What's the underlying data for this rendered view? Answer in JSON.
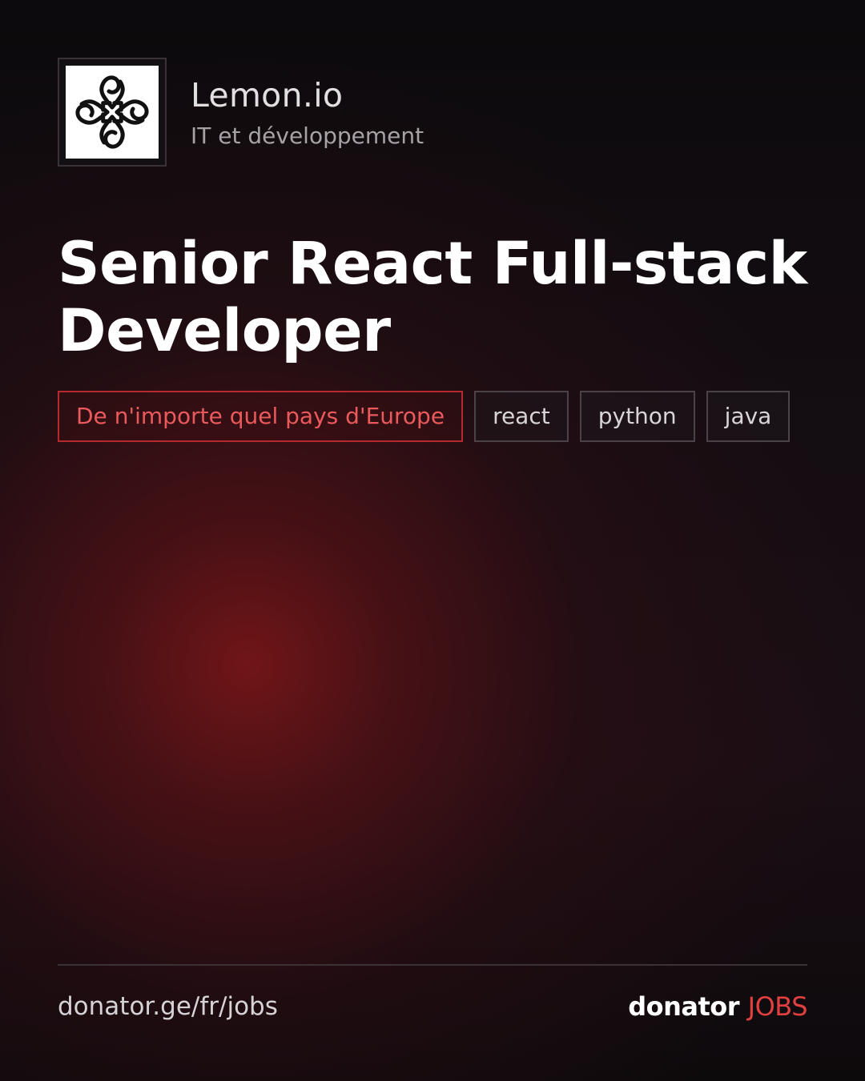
{
  "company": {
    "name": "Lemon.io",
    "category": "IT et développement",
    "logo_icon": "lemon-io-ornament-logo"
  },
  "job": {
    "title": "Senior React Full-stack Developer"
  },
  "tags": [
    {
      "label": "De n'importe quel pays d'Europe",
      "kind": "location"
    },
    {
      "label": "react",
      "kind": "skill"
    },
    {
      "label": "python",
      "kind": "skill"
    },
    {
      "label": "java",
      "kind": "skill"
    }
  ],
  "footer": {
    "url": "donator.ge/fr/jobs",
    "brand_main": "donator",
    "brand_accent": "JOBS"
  },
  "colors": {
    "background": "#0d0b0d",
    "glow": "#7a1618",
    "accent": "#e0403f",
    "tag_location_border": "#b52a2f",
    "tag_border": "#4a4247"
  }
}
